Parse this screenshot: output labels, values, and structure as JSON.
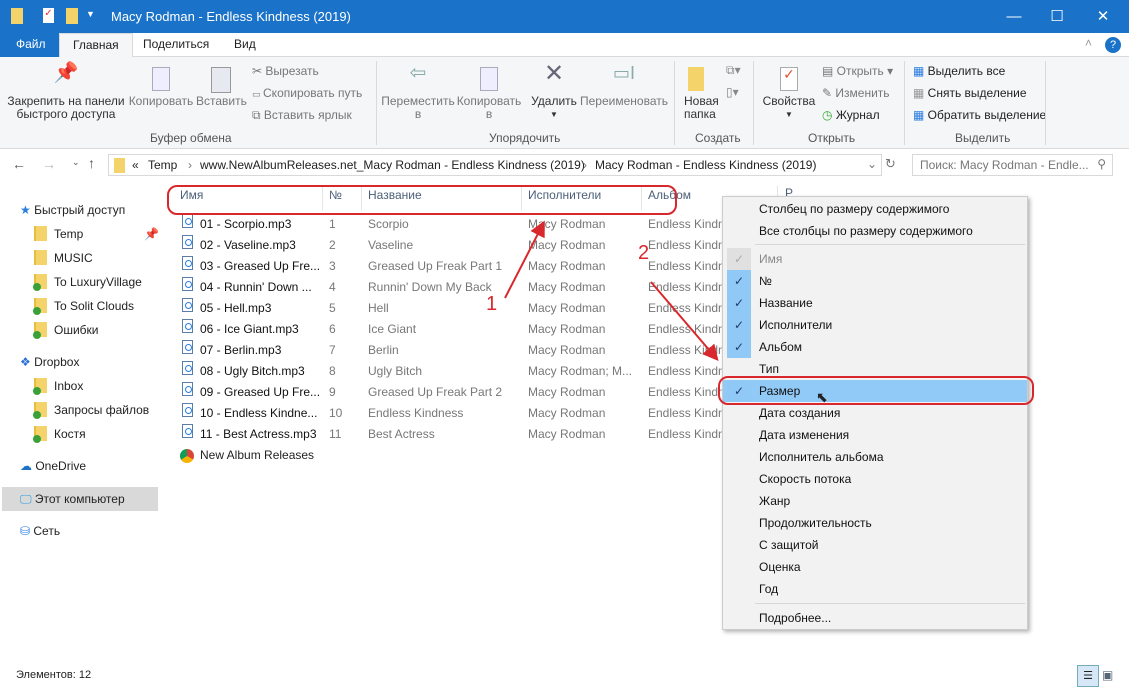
{
  "window": {
    "title": "Macy Rodman - Endless Kindness (2019)",
    "minimize": "—",
    "maximize": "☐",
    "close": "✕"
  },
  "tabs": [
    "Файл",
    "Главная",
    "Поделиться",
    "Вид"
  ],
  "ribbon": {
    "clipboard": {
      "pin": "Закрепить на панели быстрого доступа",
      "pin1": "Закрепить на панели",
      "pin2": "быстрого доступа",
      "copy": "Копировать",
      "paste": "Вставить",
      "cut": "Вырезать",
      "copy_path": "Скопировать путь",
      "paste_shortcut": "Вставить ярлык",
      "group": "Буфер обмена"
    },
    "organize": {
      "move": "Переместить",
      "move2": "в",
      "copy": "Копировать",
      "copy2": "в",
      "delete": "Удалить",
      "rename": "Переименовать",
      "group": "Упорядочить"
    },
    "new": {
      "folder1": "Новая",
      "folder2": "папка",
      "group": "Создать"
    },
    "open": {
      "properties": "Свойства",
      "open": "Открыть",
      "edit": "Изменить",
      "history": "Журнал",
      "group": "Открыть"
    },
    "select": {
      "all": "Выделить все",
      "none": "Снять выделение",
      "invert": "Обратить выделение",
      "group": "Выделить"
    }
  },
  "address": {
    "overflow": "«",
    "crumbs": [
      "Temp",
      "www.NewAlbumReleases.net_Macy Rodman - Endless Kindness (2019)",
      "Macy Rodman - Endless Kindness (2019)"
    ],
    "search_placeholder": "Поиск: Macy Rodman - Endle..."
  },
  "sidebar": {
    "quick": "Быстрый доступ",
    "quick_items": [
      "Temp",
      "MUSIC",
      "To LuxuryVillage",
      "To Solit Clouds",
      "Ошибки"
    ],
    "dropbox": "Dropbox",
    "dropbox_items": [
      "Inbox",
      "Запросы файлов",
      "Костя"
    ],
    "onedrive": "OneDrive",
    "pc": "Этот компьютер",
    "network": "Сеть"
  },
  "columns": [
    "Имя",
    "№",
    "Название",
    "Исполнители",
    "Альбом",
    "Р"
  ],
  "files": [
    {
      "name": "01 - Scorpio.mp3",
      "n": "1",
      "title": "Scorpio",
      "artist": "Macy Rodman",
      "album": "Endless Kindn"
    },
    {
      "name": "02 - Vaseline.mp3",
      "n": "2",
      "title": "Vaseline",
      "artist": "Macy Rodman",
      "album": "Endless Kindn"
    },
    {
      "name": "03 - Greased Up Fre...",
      "n": "3",
      "title": "Greased Up Freak Part 1",
      "artist": "Macy Rodman",
      "album": "Endless Kindn"
    },
    {
      "name": "04 - Runnin' Down ...",
      "n": "4",
      "title": "Runnin' Down My Back",
      "artist": "Macy Rodman",
      "album": "Endless Kindn"
    },
    {
      "name": "05 - Hell.mp3",
      "n": "5",
      "title": "Hell",
      "artist": "Macy Rodman",
      "album": "Endless Kindn"
    },
    {
      "name": "06 - Ice Giant.mp3",
      "n": "6",
      "title": "Ice Giant",
      "artist": "Macy Rodman",
      "album": "Endless Kindn"
    },
    {
      "name": "07 - Berlin.mp3",
      "n": "7",
      "title": "Berlin",
      "artist": "Macy Rodman",
      "album": "Endless Kindn"
    },
    {
      "name": "08 - Ugly Bitch.mp3",
      "n": "8",
      "title": "Ugly Bitch",
      "artist": "Macy Rodman; M...",
      "album": "Endless Kindn"
    },
    {
      "name": "09 - Greased Up Fre...",
      "n": "9",
      "title": "Greased Up Freak Part 2",
      "artist": "Macy Rodman",
      "album": "Endless Kindn"
    },
    {
      "name": "10 - Endless Kindne...",
      "n": "10",
      "title": "Endless Kindness",
      "artist": "Macy Rodman",
      "album": "Endless Kindn"
    },
    {
      "name": "11 - Best Actress.mp3",
      "n": "11",
      "title": "Best Actress",
      "artist": "Macy Rodman",
      "album": "Endless Kindn"
    }
  ],
  "shortcut": "New Album Releases",
  "menu": {
    "fit": "Столбец по размеру содержимого",
    "fit_all": "Все столбцы по размеру содержимого",
    "items": [
      {
        "label": "Имя",
        "checked": true,
        "disabled": true
      },
      {
        "label": "№",
        "checked": true
      },
      {
        "label": "Название",
        "checked": true
      },
      {
        "label": "Исполнители",
        "checked": true
      },
      {
        "label": "Альбом",
        "checked": true
      },
      {
        "label": "Тип",
        "checked": false
      },
      {
        "label": "Размер",
        "checked": true,
        "highlighted": true
      },
      {
        "label": "Дата создания",
        "checked": false
      },
      {
        "label": "Дата изменения",
        "checked": false
      },
      {
        "label": "Исполнитель альбома",
        "checked": false
      },
      {
        "label": "Скорость потока",
        "checked": false
      },
      {
        "label": "Жанр",
        "checked": false
      },
      {
        "label": "Продолжительность",
        "checked": false
      },
      {
        "label": "С защитой",
        "checked": false
      },
      {
        "label": "Оценка",
        "checked": false
      },
      {
        "label": "Год",
        "checked": false
      }
    ],
    "more": "Подробнее..."
  },
  "annotations": {
    "one": "1",
    "two": "2",
    "color": "#d8282d"
  },
  "status": {
    "count": "Элементов: 12"
  }
}
